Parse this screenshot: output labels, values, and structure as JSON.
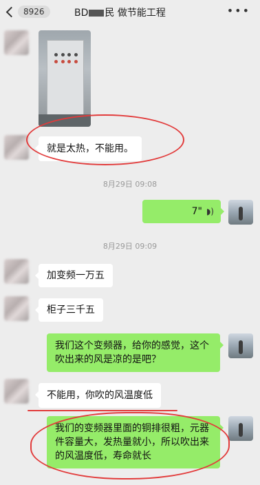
{
  "header": {
    "back_badge": "8926",
    "title_prefix": "BD",
    "title_suffix": "民 做节能工程",
    "more_label": "•••"
  },
  "messages": {
    "m1": "就是太热，不能用。",
    "time1": "8月29日 09:08",
    "voice_duration": "7\"",
    "time2": "8月29日 09:09",
    "m2": "加变频一万五",
    "m3": "柜子三千五",
    "m4": "我们这个变频器，给你的感觉，这个吹出来的风是凉的是吧？",
    "m5": "不能用，你吹的风温度低",
    "m6": "我们的变频器里面的铜排很粗，元器件容量大，发热量就小，所以吹出来的风温度低，寿命就长"
  },
  "colors": {
    "outgoing_bubble": "#95ec69",
    "incoming_bubble": "#ffffff",
    "annotation_red": "#e23b3b",
    "background": "#ededed"
  }
}
